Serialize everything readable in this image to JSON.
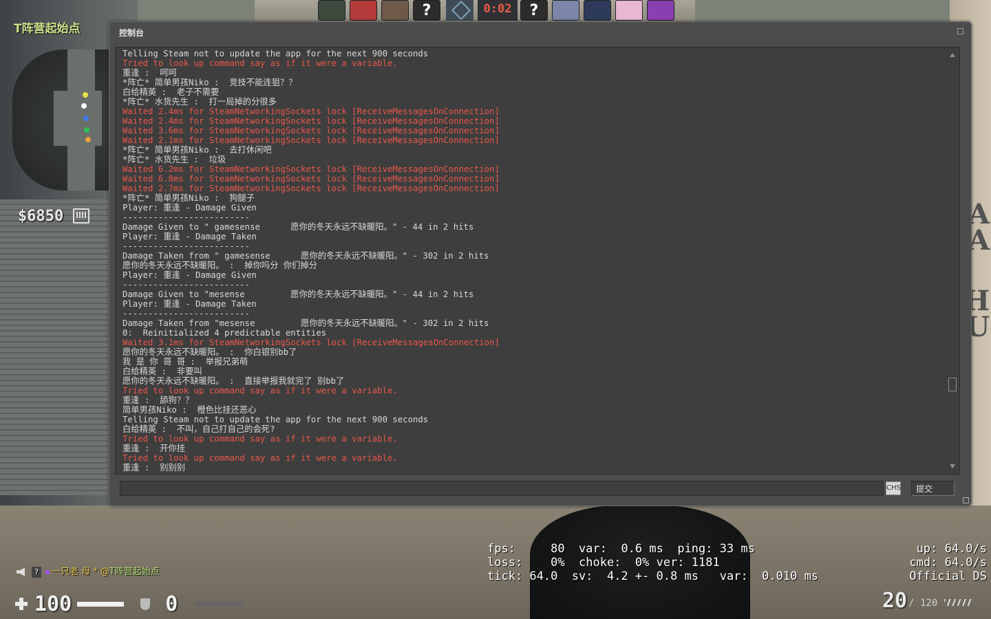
{
  "hud": {
    "location": "T阵营起始点",
    "money": "$6850",
    "timer": "0:02",
    "voice": {
      "prefix": "?",
      "speaker": "一只老 母 * @",
      "location": "T阵营起始点"
    },
    "health": "100",
    "armor": "0",
    "ammo_clip": "20",
    "ammo_reserve": "/ 120",
    "wall_text": [
      "PA",
      "KA",
      "H",
      "AU"
    ]
  },
  "netgraph": {
    "left_lines": [
      "fps:     80  var:  0.6 ms  ping: 33 ms",
      "loss:    0%  choke:  0% ver: 1181",
      "tick: 64.0  sv:  4.2 +- 0.8 ms   var:  0.010 ms"
    ],
    "right_lines": [
      "up: 64.0/s",
      "cmd: 64.0/s",
      "Official DS"
    ]
  },
  "console": {
    "title": "控制台",
    "ime_label": "CHS",
    "submit_label": "提交",
    "input_value": "",
    "lines": [
      {
        "t": "Telling Steam not to update the app for the next 900 seconds",
        "c": "w"
      },
      {
        "t": "Tried to look up command say as if it were a variable.",
        "c": "r"
      },
      {
        "t": "重逢 :  呵呵",
        "c": "w"
      },
      {
        "t": "*阵亡* 简单男孩Niko :  竞技不能连狙？？",
        "c": "w"
      },
      {
        "t": "白给精英 :  老子不需要",
        "c": "w"
      },
      {
        "t": "*阵亡* 水货先生 :  打一局掉的分很多",
        "c": "w"
      },
      {
        "t": "Waited 2.4ms for SteamNetworkingSockets lock [ReceiveMessagesOnConnection]",
        "c": "r"
      },
      {
        "t": "Waited 2.4ms for SteamNetworkingSockets lock [ReceiveMessagesOnConnection]",
        "c": "r"
      },
      {
        "t": "Waited 3.6ms for SteamNetworkingSockets lock [ReceiveMessagesOnConnection]",
        "c": "r"
      },
      {
        "t": "Waited 2.1ms for SteamNetworkingSockets lock [ReceiveMessagesOnConnection]",
        "c": "r"
      },
      {
        "t": "*阵亡* 简单男孩Niko :  去打休闲吧",
        "c": "w"
      },
      {
        "t": "*阵亡* 水货先生 :  垃圾",
        "c": "w"
      },
      {
        "t": "Waited 6.2ms for SteamNetworkingSockets lock [ReceiveMessagesOnConnection]",
        "c": "r"
      },
      {
        "t": "Waited 6.8ms for SteamNetworkingSockets lock [ReceiveMessagesOnConnection]",
        "c": "r"
      },
      {
        "t": "Waited 2.7ms for SteamNetworkingSockets lock [ReceiveMessagesOnConnection]",
        "c": "r"
      },
      {
        "t": "*阵亡* 简单男孩Niko :  狗腿子",
        "c": "w"
      },
      {
        "t": "Player: 重逢 - Damage Given",
        "c": "w"
      },
      {
        "t": "-------------------------",
        "c": "w"
      },
      {
        "t": "Damage Given to \" gamesense      愿你的冬天永远不缺暖阳。\" - 44 in 2 hits",
        "c": "w"
      },
      {
        "t": "Player: 重逢 - Damage Taken",
        "c": "w"
      },
      {
        "t": "-------------------------",
        "c": "w"
      },
      {
        "t": "Damage Taken from \" gamesense      愿你的冬天永远不缺暖阳。\" - 302 in 2 hits",
        "c": "w"
      },
      {
        "t": "愿你的冬天永远不缺暖阳。 :  掉你吗分 你们掉分",
        "c": "w"
      },
      {
        "t": "Player: 重逢 - Damage Given",
        "c": "w"
      },
      {
        "t": "-------------------------",
        "c": "w"
      },
      {
        "t": "Damage Given to \"mesense         愿你的冬天永远不缺暖阳。\" - 44 in 2 hits",
        "c": "w"
      },
      {
        "t": "Player: 重逢 - Damage Taken",
        "c": "w"
      },
      {
        "t": "-------------------------",
        "c": "w"
      },
      {
        "t": "Damage Taken from \"mesense         愿你的冬天永远不缺暖阳。\" - 302 in 2 hits",
        "c": "w"
      },
      {
        "t": "0:  Reinitialized 4 predictable entities",
        "c": "w"
      },
      {
        "t": "Waited 3.1ms for SteamNetworkingSockets lock [ReceiveMessagesOnConnection]",
        "c": "r"
      },
      {
        "t": "愿你的冬天永远不缺暖阳。 :  你白银别bb了",
        "c": "w"
      },
      {
        "t": "我 是 你 哥 哥 :  举报兄弟萌",
        "c": "w"
      },
      {
        "t": "白给精英 :  非要叫",
        "c": "w"
      },
      {
        "t": "愿你的冬天永远不缺暖阳。 :  直接举报我就完了 别bb了",
        "c": "w"
      },
      {
        "t": "Tried to look up command say as if it were a variable.",
        "c": "r"
      },
      {
        "t": "重逢 :  舔狗？？",
        "c": "w"
      },
      {
        "t": "简单男孩Niko :  橙色比挂还恶心",
        "c": "w"
      },
      {
        "t": "Telling Steam not to update the app for the next 900 seconds",
        "c": "w"
      },
      {
        "t": "白给精英 :  不叫，自己打自己的会死?",
        "c": "w"
      },
      {
        "t": "Tried to look up command say as if it were a variable.",
        "c": "r"
      },
      {
        "t": "重逢 :  开你挂",
        "c": "w"
      },
      {
        "t": "Tried to look up command say as if it were a variable.",
        "c": "r"
      },
      {
        "t": "重逢 :  别别别",
        "c": "w"
      }
    ]
  }
}
